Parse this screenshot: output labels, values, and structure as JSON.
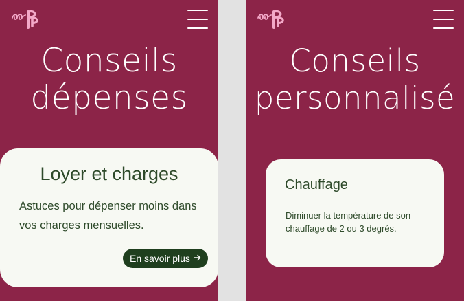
{
  "colors": {
    "panel_bg": "#8c2448",
    "card_bg": "#f7f9f3",
    "text_green": "#2e4a2a",
    "button_bg": "#1f3f1e",
    "logo_pink": "#f3a9c8",
    "gap_bg": "#e2e2e2"
  },
  "left_screen": {
    "logo_icon": "brand-logo-icon",
    "menu_icon": "hamburger-menu-icon",
    "hero_line1": "Conseils",
    "hero_line2": "dépenses",
    "card": {
      "title": "Loyer et charges",
      "text": "Astuces pour dépenser moins dans vos charges mensuelles.",
      "button_label": "En savoir plus",
      "button_icon": "arrow-right-icon"
    }
  },
  "right_screen": {
    "logo_icon": "brand-logo-icon",
    "menu_icon": "hamburger-menu-icon",
    "hero_line1": "Conseils",
    "hero_line2": "personnalisé",
    "card": {
      "title": "Chauffage",
      "text": "Diminuer la température de son chauffage de 2 ou 3 degrés."
    }
  }
}
